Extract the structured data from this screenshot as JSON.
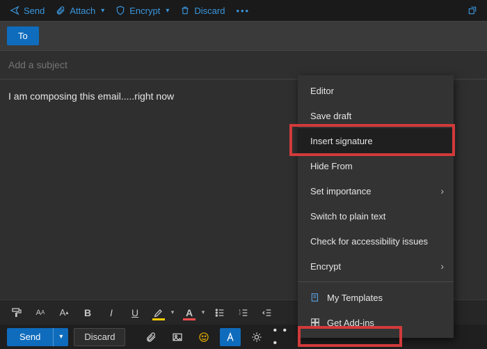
{
  "colors": {
    "accent": "#3a96dd",
    "primary": "#0f6cbd",
    "callout": "#d23a3a"
  },
  "top_toolbar": {
    "send": {
      "label": "Send"
    },
    "attach": {
      "label": "Attach"
    },
    "encrypt": {
      "label": "Encrypt"
    },
    "discard": {
      "label": "Discard"
    }
  },
  "compose": {
    "to_label": "To",
    "subject_placeholder": "Add a subject",
    "subject_value": "",
    "body_text": "I am composing this email.....right now"
  },
  "context_menu": {
    "items": [
      {
        "label": "Editor"
      },
      {
        "label": "Save draft"
      },
      {
        "label": "Insert signature",
        "highlighted": true
      },
      {
        "label": "Hide From"
      },
      {
        "label": "Set importance",
        "submenu": true
      },
      {
        "label": "Switch to plain text"
      },
      {
        "label": "Check for accessibility issues"
      },
      {
        "label": "Encrypt",
        "submenu": true
      },
      {
        "label": "My Templates",
        "icon": "templates"
      },
      {
        "label": "Get Add-ins",
        "icon": "addins"
      }
    ]
  },
  "bottom_bar": {
    "send_label": "Send",
    "discard_label": "Discard",
    "more_label": "• • •"
  },
  "format_bar": {
    "items": [
      "format-painter",
      "font-size-decrease",
      "font-size-increase",
      "bold",
      "italic",
      "underline",
      "highlight-color",
      "font-color",
      "bulleted-list",
      "numbered-list",
      "decrease-indent",
      "increase-indent",
      "strikethrough"
    ]
  }
}
